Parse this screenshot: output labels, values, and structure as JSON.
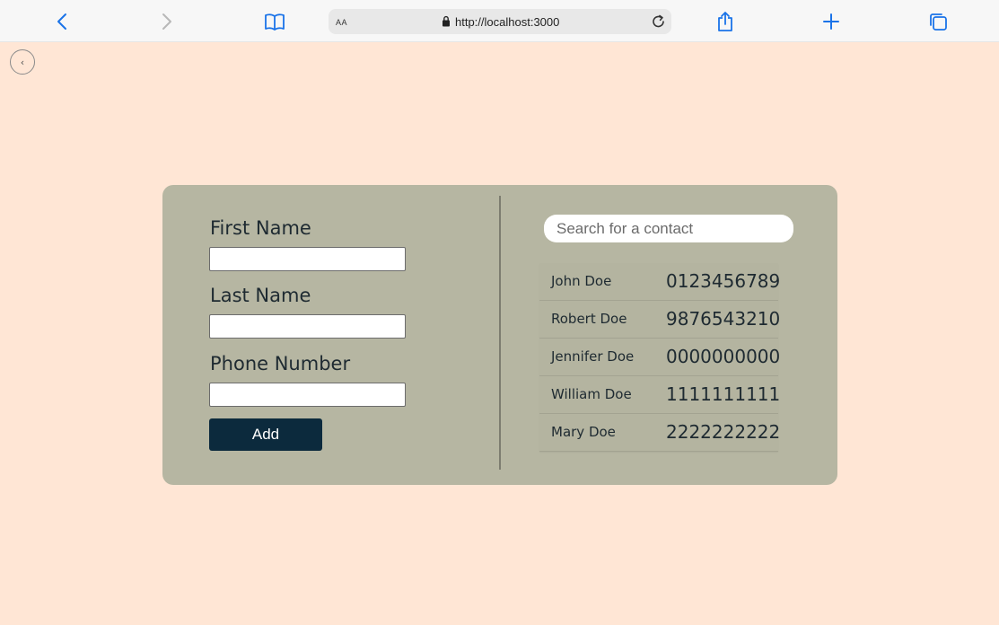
{
  "browser": {
    "text_size_label": "AA",
    "url": "http://localhost:3000",
    "icons": {
      "back": "chevron-left-icon",
      "forward": "chevron-right-icon",
      "bookmarks": "book-icon",
      "lock": "lock-icon",
      "reload": "reload-icon",
      "share": "share-icon",
      "new_tab": "plus-icon",
      "tabs": "tabs-icon"
    },
    "accent_color": "#1a73e8"
  },
  "page": {
    "back_button_icon": "chevron-left-icon",
    "background_color": "#ffe6d5"
  },
  "form": {
    "first_name_label": "First Name",
    "first_name_value": "",
    "last_name_label": "Last Name",
    "last_name_value": "",
    "phone_label": "Phone Number",
    "phone_value": "",
    "add_button_label": "Add",
    "card_color": "#b6b6a2",
    "button_color": "#0c2a3d"
  },
  "search": {
    "placeholder": "Search for a contact",
    "value": ""
  },
  "contacts": [
    {
      "name": "John Doe",
      "phone": "0123456789"
    },
    {
      "name": "Robert Doe",
      "phone": "9876543210"
    },
    {
      "name": "Jennifer Doe",
      "phone": "0000000000"
    },
    {
      "name": "William Doe",
      "phone": "1111111111"
    },
    {
      "name": "Mary Doe",
      "phone": "2222222222"
    }
  ]
}
